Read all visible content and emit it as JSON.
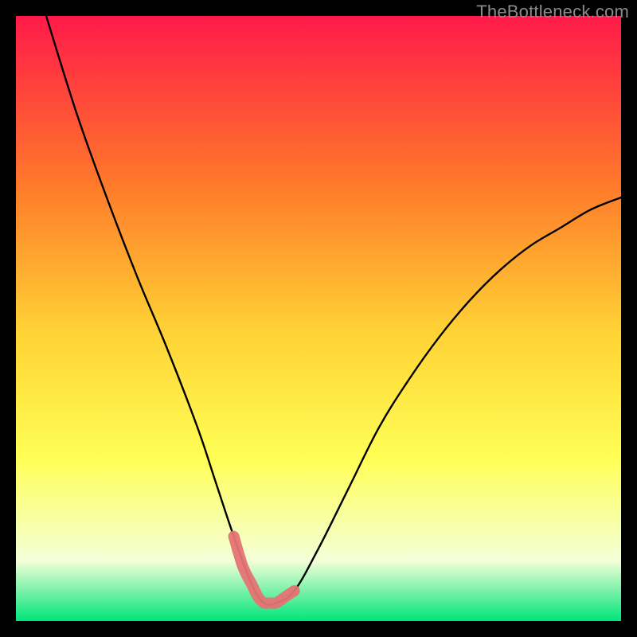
{
  "watermark": "TheBottleneck.com",
  "colors": {
    "gradient_top": "#ff1a49",
    "gradient_mid1": "#ff7a2a",
    "gradient_mid2": "#ffd235",
    "gradient_mid3": "#ffff55",
    "gradient_mid4": "#f4ffd8",
    "gradient_bottom": "#00e57a",
    "curve": "#000000",
    "highlight": "#e57373",
    "frame": "#000000"
  },
  "chart_data": {
    "type": "line",
    "title": "",
    "xlabel": "",
    "ylabel": "",
    "xlim": [
      0,
      100
    ],
    "ylim": [
      0,
      100
    ],
    "annotations": [],
    "series": [
      {
        "name": "bottleneck-curve",
        "x": [
          5,
          10,
          15,
          20,
          25,
          30,
          33,
          36,
          39,
          41,
          43,
          46,
          50,
          55,
          60,
          65,
          70,
          75,
          80,
          85,
          90,
          95,
          100
        ],
        "y": [
          100,
          84,
          70,
          57,
          45,
          32,
          23,
          14,
          6,
          3,
          3,
          5,
          12,
          22,
          32,
          40,
          47,
          53,
          58,
          62,
          65,
          68,
          70
        ]
      },
      {
        "name": "valley-highlight",
        "x": [
          36,
          37.5,
          39,
          40,
          41,
          42,
          43,
          44.5,
          46
        ],
        "y": [
          14,
          9,
          6,
          4,
          3,
          3,
          3,
          4,
          5
        ]
      }
    ]
  }
}
